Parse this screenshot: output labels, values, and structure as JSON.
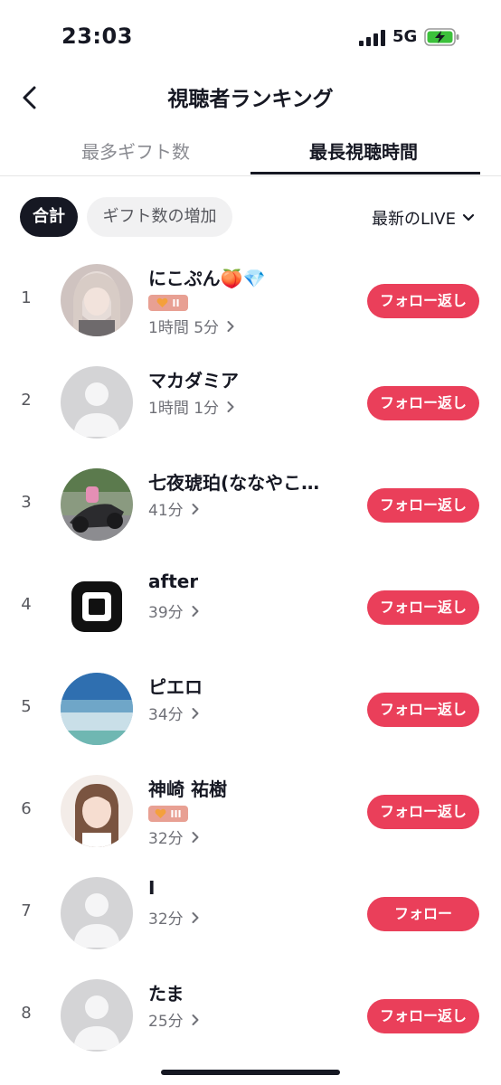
{
  "status_bar": {
    "time": "23:03",
    "network": "5G"
  },
  "header": {
    "title": "視聴者ランキング"
  },
  "tabs": [
    {
      "label": "最多ギフト数",
      "active": false
    },
    {
      "label": "最長視聴時間",
      "active": true
    }
  ],
  "filters": {
    "chip_total": "合計",
    "chip_gift_increase": "ギフト数の増加",
    "sort_label": "最新のLIVE"
  },
  "viewers": [
    {
      "rank": "1",
      "name": "にこぷん🍑💎",
      "badge": "II",
      "duration": "1時間 5分",
      "button": "フォロー返し"
    },
    {
      "rank": "2",
      "name": "マカダミア",
      "duration": "1時間 1分",
      "button": "フォロー返し"
    },
    {
      "rank": "3",
      "name": "七夜琥珀(ななやこ…",
      "duration": "41分",
      "button": "フォロー返し"
    },
    {
      "rank": "4",
      "name": "after",
      "duration": "39分",
      "button": "フォロー返し"
    },
    {
      "rank": "5",
      "name": "ピエロ",
      "duration": "34分",
      "button": "フォロー返し"
    },
    {
      "rank": "6",
      "name": "神崎 祐樹",
      "badge": "III",
      "duration": "32分",
      "button": "フォロー返し"
    },
    {
      "rank": "7",
      "name": "I",
      "duration": "32分",
      "button": "フォロー"
    },
    {
      "rank": "8",
      "name": "たま",
      "duration": "25分",
      "button": "フォロー返し"
    }
  ],
  "colors": {
    "accent": "#ea3f5a",
    "badge": "#e8a093",
    "text": "#161823",
    "secondary": "#6f7077"
  }
}
